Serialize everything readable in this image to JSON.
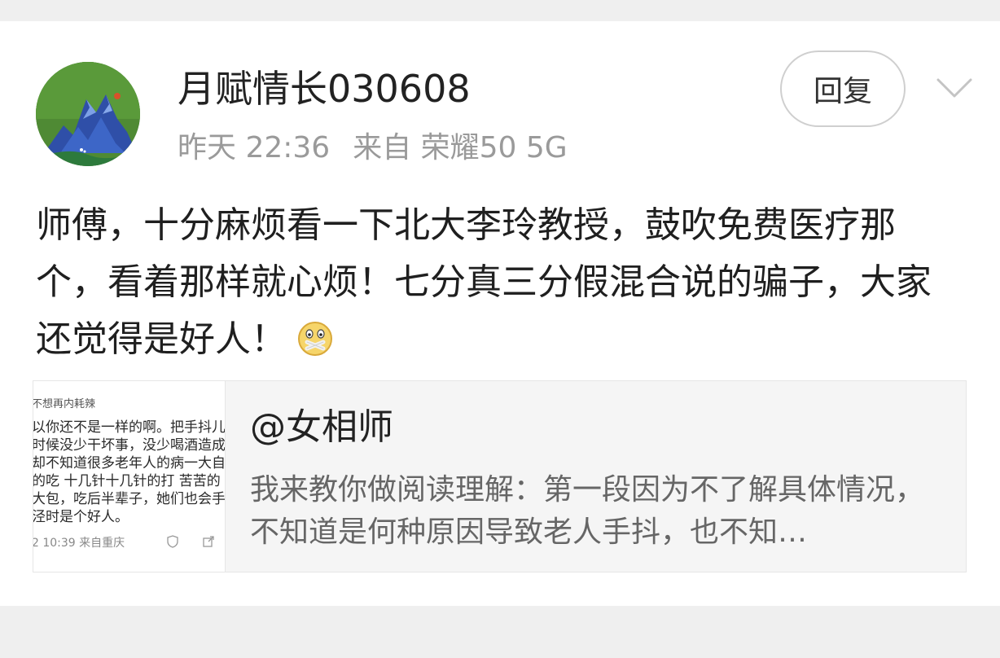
{
  "post": {
    "username": "月赋情长030608",
    "time": "昨天 22:36",
    "source": "来自 荣耀50 5G",
    "reply_label": "回复",
    "more_icon": "chevron-down-icon",
    "text": "师傅，十分麻烦看一下北大李玲教授，鼓吹免费医疗那个，看着那样就心烦！七分真三分假混合说的骗子，大家还觉得是好人！",
    "emoji": "zipped-mouth-emoji"
  },
  "quoted": {
    "user": "@女相师",
    "text": "我来教你做阅读理解：第一段因为不了解具体情况，不知道是何种原因导致老人手抖，也不知…",
    "thumbnail": {
      "lines": [
        "不想再内耗辣",
        "以你还不是一样的啊。把手抖儿",
        "时候没少干坏事，没少喝酒造成",
        "却不知道很多老年人的病一大自",
        "的吃 十几针十几针的打 苦苦的",
        "大包，吃后半辈子，她们也会手",
        "泾时是个好人。"
      ],
      "footer": "2 10:39  来自重庆"
    }
  },
  "colors": {
    "page_bg": "#efefef",
    "card_bg": "#ffffff",
    "meta_text": "#9a9a9a",
    "quote_bg": "#f5f5f5"
  }
}
